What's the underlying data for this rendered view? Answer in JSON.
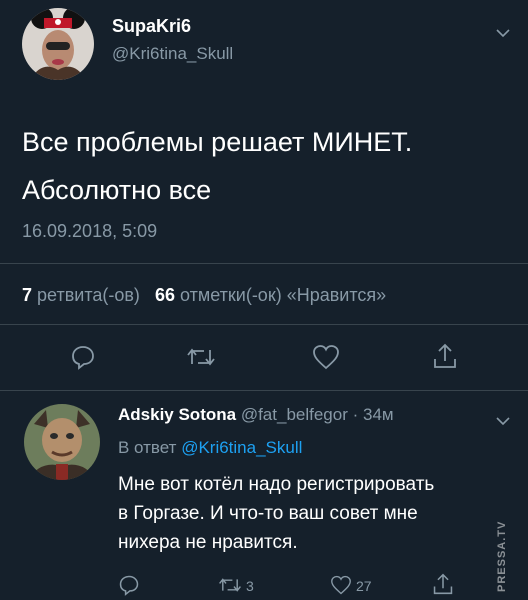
{
  "main_tweet": {
    "display_name": "SupaKri6",
    "handle": "@Kri6tina_Skull",
    "text_line1": "Все проблемы решает МИНЕТ.",
    "text_line2": "Абсолютно все",
    "timestamp": "16.09.2018, 5:09",
    "retweet_count": "7",
    "retweet_label": "ретвита(-ов)",
    "like_count": "66",
    "like_label": "отметки(-ок) «Нравится»"
  },
  "reply_tweet": {
    "display_name": "Adskiy Sotona",
    "handle": "@fat_belfegor",
    "separator": "·",
    "time_ago": "34м",
    "in_reply_prefix": "В ответ",
    "in_reply_handle": "@Kri6tina_Skull",
    "text_line1": "Мне вот котёл надо регистрировать",
    "text_line2": "в Горгазе. И что-то ваш совет мне",
    "text_line3": "нихера не нравится.",
    "retweet_count": "3",
    "like_count": "27"
  },
  "watermark": "PRESSA.TV",
  "colors": {
    "background": "#15202b",
    "text": "#ffffff",
    "secondary": "#8899a6",
    "link": "#1da1f2",
    "divider": "#38444d"
  }
}
